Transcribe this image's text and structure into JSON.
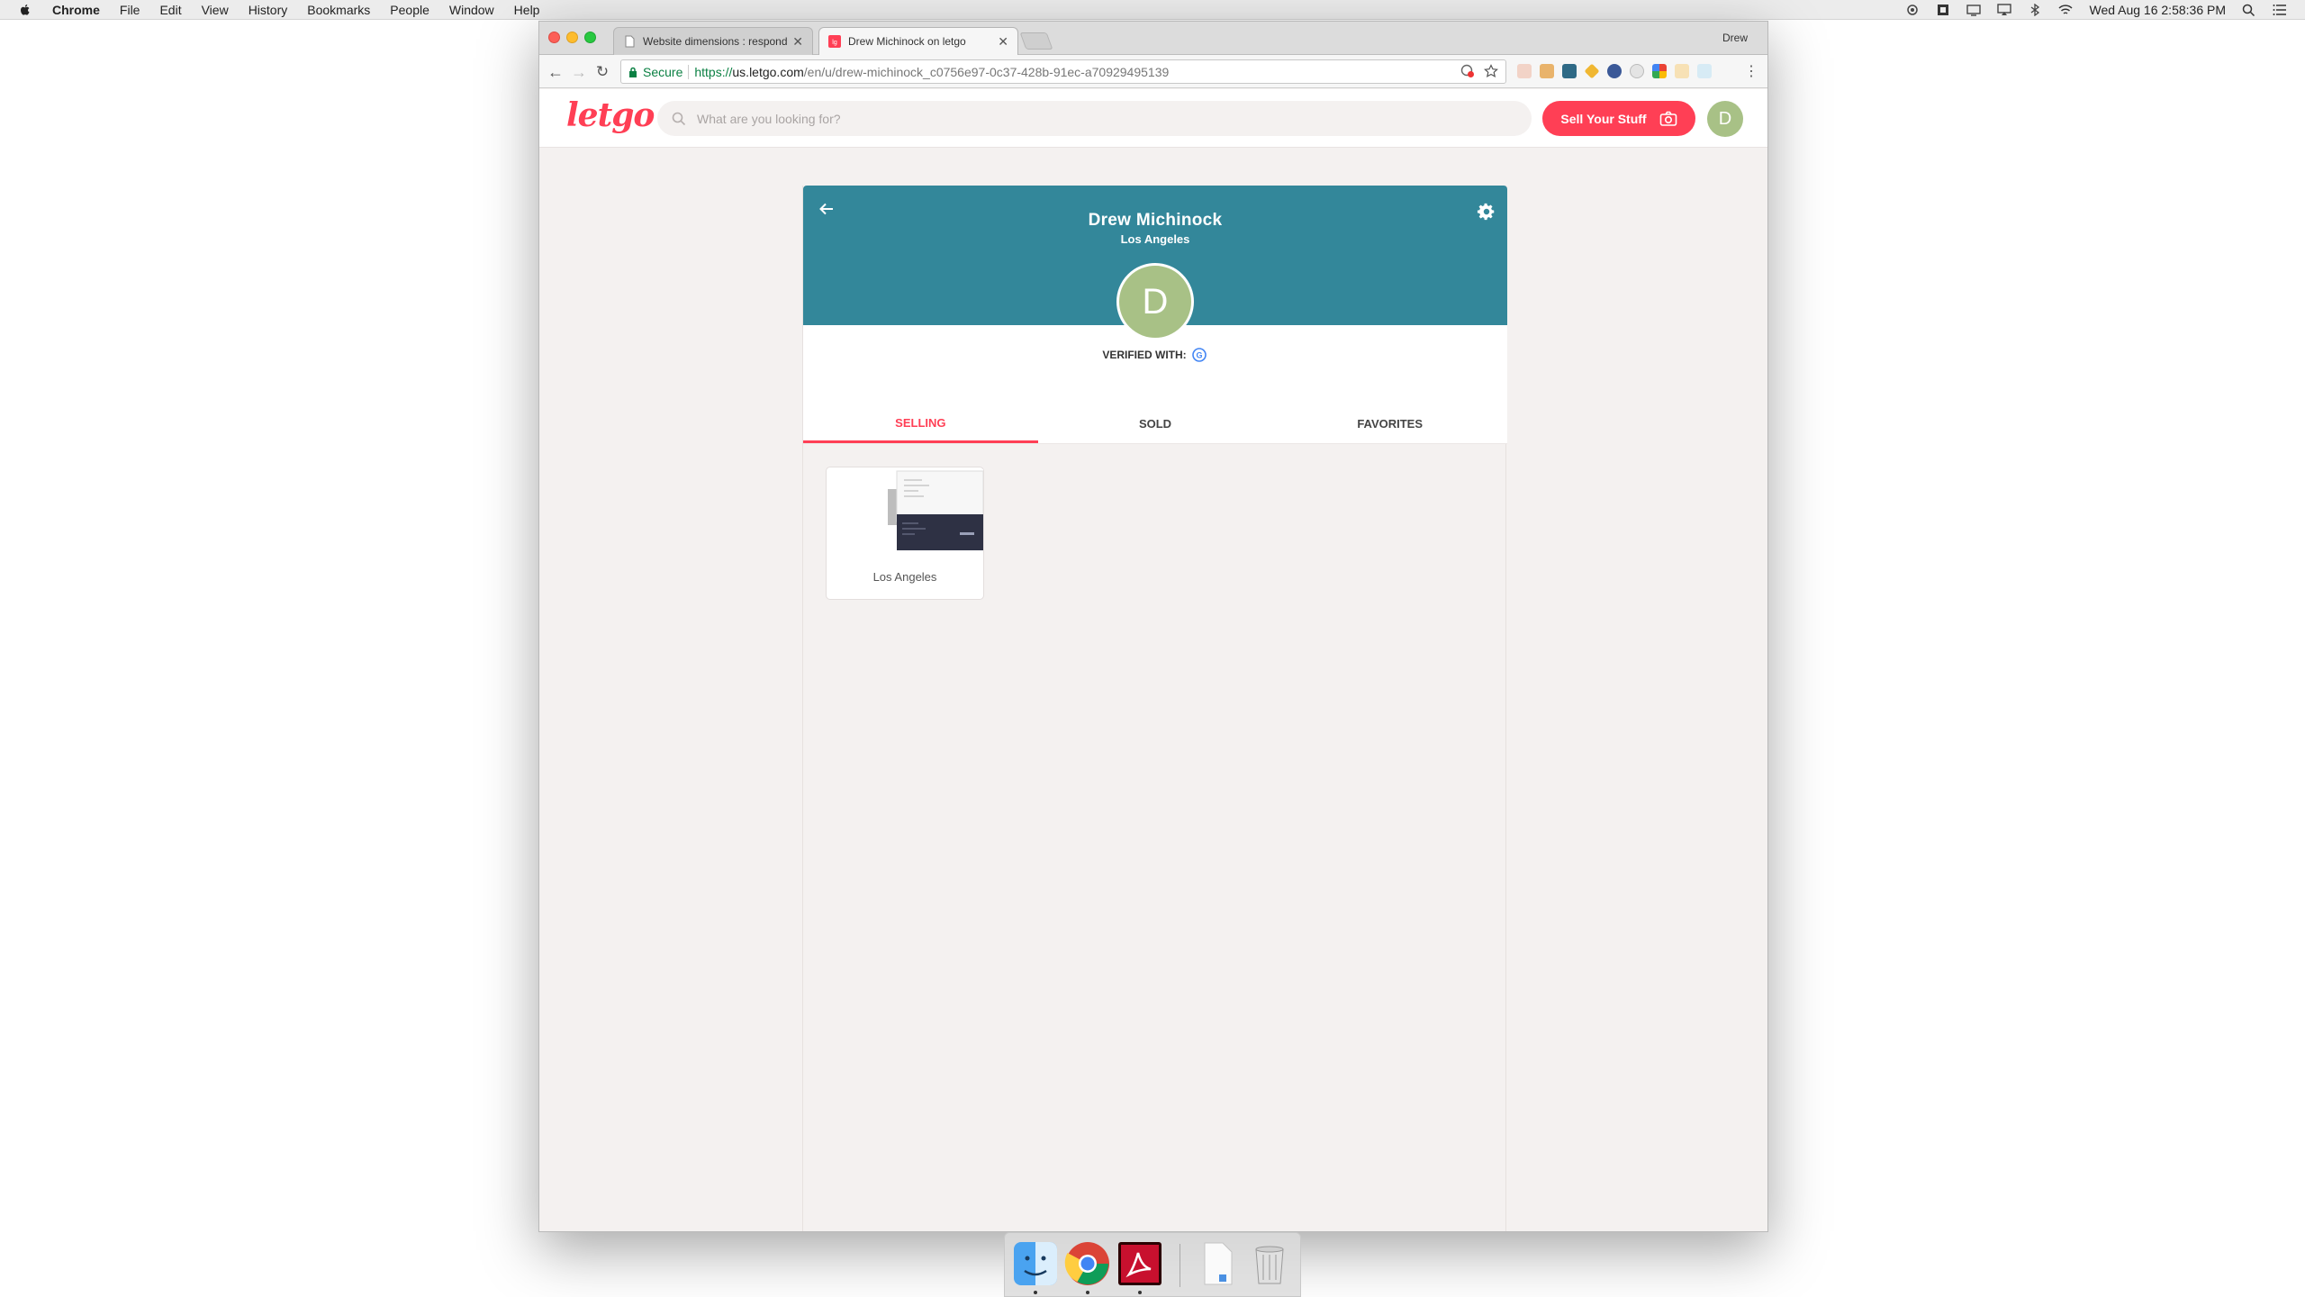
{
  "menubar": {
    "app_name": "Chrome",
    "menus": [
      "File",
      "Edit",
      "View",
      "History",
      "Bookmarks",
      "People",
      "Window",
      "Help"
    ],
    "clock": "Wed Aug 16  2:58:36 PM"
  },
  "browser": {
    "tabs": [
      {
        "title": "Website dimensions : respond",
        "active": false
      },
      {
        "title": "Drew Michinock on letgo",
        "active": true
      }
    ],
    "profile_name": "Drew",
    "secure_label": "Secure",
    "url_scheme": "https://",
    "url_host": "us.letgo.com",
    "url_path": "/en/u/drew-michinock_c0756e97-0c37-428b-91ec-a70929495139"
  },
  "site": {
    "logo": "letgo",
    "search_placeholder": "What are you looking for?",
    "sell_button": "Sell Your Stuff",
    "user_initial": "D",
    "brand_color": "#ff3f55",
    "banner_color": "#33879a",
    "avatar_color": "#a8c186"
  },
  "profile": {
    "name": "Drew Michinock",
    "location": "Los Angeles",
    "initial": "D",
    "verified_label": "VERIFIED WITH:",
    "tabs": [
      {
        "label": "SELLING",
        "active": true
      },
      {
        "label": "SOLD",
        "active": false
      },
      {
        "label": "FAVORITES",
        "active": false
      }
    ],
    "listings": [
      {
        "location": "Los Angeles"
      }
    ]
  },
  "dock": {
    "apps": [
      "finder-icon",
      "chrome-icon",
      "acrobat-icon",
      "document-icon",
      "trash-icon"
    ]
  }
}
